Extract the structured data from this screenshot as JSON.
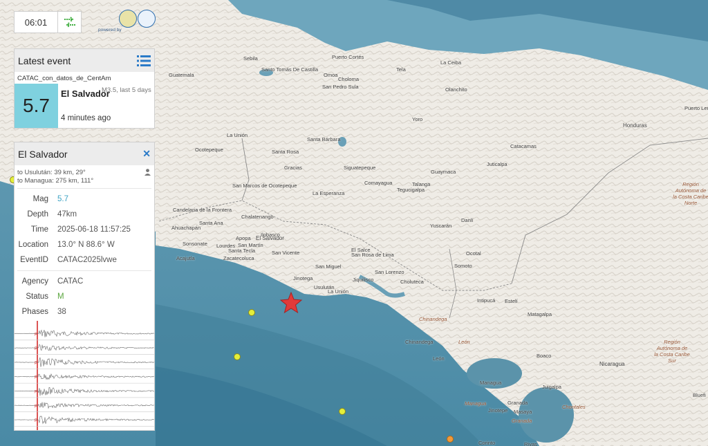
{
  "clock": {
    "time": "06:01"
  },
  "logos": {
    "powered_by": "powered by",
    "primary_color": "#2f6fb0"
  },
  "latest": {
    "title": "Latest event",
    "source": "CATAC_con_datos_de_CentAm",
    "magnitude": "5.7",
    "region": "El Salvador",
    "other": "M3.5, last 5 days",
    "ago": "4 minutes ago",
    "mag_color": "#7fd1df"
  },
  "detail": {
    "title": "El Salvador",
    "dist1": "to Usulután: 39 km, 29°",
    "dist2": "to Managua: 275 km, 111°",
    "mag_label": "Mag",
    "mag_value": "5.7",
    "depth_label": "Depth",
    "depth_value": "47km",
    "time_label": "Time",
    "time_value": "2025-06-18 11:57:25",
    "location_label": "Location",
    "location_value": "13.0° N 88.6° W",
    "eventid_label": "EventID",
    "eventid_value": "CATAC2025lvwe",
    "agency_label": "Agency",
    "agency_value": "CATAC",
    "status_label": "Status",
    "status_value": "M",
    "phases_label": "Phases",
    "phases_value": "38",
    "trace_count": 7
  },
  "map": {
    "places": [
      {
        "name": "Puerto Cortés",
        "type": "city"
      },
      {
        "name": "Sebila",
        "type": "city"
      },
      {
        "name": "Santo Tomás De Castilla",
        "type": "city"
      },
      {
        "name": "Omoa",
        "type": "city"
      },
      {
        "name": "Choloma",
        "type": "city"
      },
      {
        "name": "San Pedro Sula",
        "type": "city"
      },
      {
        "name": "La Ceiba",
        "type": "city"
      },
      {
        "name": "Tela",
        "type": "city"
      },
      {
        "name": "Olanchito",
        "type": "city"
      },
      {
        "name": "Guatemala",
        "type": "city"
      },
      {
        "name": "Yoro",
        "type": "city"
      },
      {
        "name": "Honduras",
        "type": "country"
      },
      {
        "name": "Puerto Lempira",
        "type": "city"
      },
      {
        "name": "La Unión",
        "type": "city"
      },
      {
        "name": "Ocotepeque",
        "type": "city"
      },
      {
        "name": "Santa Rosa",
        "type": "city"
      },
      {
        "name": "Santa Bárbara",
        "type": "city"
      },
      {
        "name": "Gracias",
        "type": "city"
      },
      {
        "name": "Siguatepeque",
        "type": "city"
      },
      {
        "name": "Comayagua",
        "type": "city"
      },
      {
        "name": "Talanga",
        "type": "city"
      },
      {
        "name": "Guaymaca",
        "type": "city"
      },
      {
        "name": "Juticalpa",
        "type": "city"
      },
      {
        "name": "Catacamas",
        "type": "city"
      },
      {
        "name": "Región Autónoma de la Costa Caribe Norte",
        "type": "region"
      },
      {
        "name": "San Marcos de Ocotepeque",
        "type": "city"
      },
      {
        "name": "La Esperanza",
        "type": "city"
      },
      {
        "name": "Tegucigalpa",
        "type": "city"
      },
      {
        "name": "Candelaria de la Frontera",
        "type": "city"
      },
      {
        "name": "Chalatenango",
        "type": "city"
      },
      {
        "name": "Santa Ana",
        "type": "city"
      },
      {
        "name": "Ahuachapán",
        "type": "city"
      },
      {
        "name": "Sonsonate",
        "type": "city"
      },
      {
        "name": "Apopa",
        "type": "city"
      },
      {
        "name": "El Salvador",
        "type": "country"
      },
      {
        "name": "Ilobasco",
        "type": "city"
      },
      {
        "name": "Lourdes",
        "type": "city"
      },
      {
        "name": "San Martín",
        "type": "city"
      },
      {
        "name": "Santa Tecla",
        "type": "city"
      },
      {
        "name": "Acajutla",
        "type": "city"
      },
      {
        "name": "Zacatecoluca",
        "type": "city"
      },
      {
        "name": "San Vicente",
        "type": "city"
      },
      {
        "name": "Yuscarán",
        "type": "city"
      },
      {
        "name": "Danlí",
        "type": "city"
      },
      {
        "name": "El Salce",
        "type": "city"
      },
      {
        "name": "San Rosa de Lima",
        "type": "city"
      },
      {
        "name": "San Miguel",
        "type": "city"
      },
      {
        "name": "San Lorenzo",
        "type": "city"
      },
      {
        "name": "Choluteca",
        "type": "city"
      },
      {
        "name": "Ocotal",
        "type": "city"
      },
      {
        "name": "Somoto",
        "type": "city"
      },
      {
        "name": "Jinotega",
        "type": "city"
      },
      {
        "name": "Usulután",
        "type": "city"
      },
      {
        "name": "Jiquilisco",
        "type": "city"
      },
      {
        "name": "La Unión",
        "type": "city"
      },
      {
        "name": "Intipucá",
        "type": "city"
      },
      {
        "name": "Estelí",
        "type": "city"
      },
      {
        "name": "Matagalpa",
        "type": "city"
      },
      {
        "name": "Chinandega",
        "type": "region"
      },
      {
        "name": "Chinandega",
        "type": "city"
      },
      {
        "name": "León",
        "type": "region"
      },
      {
        "name": "León",
        "type": "city"
      },
      {
        "name": "Región Autónoma de la Costa Caribe Sur",
        "type": "region"
      },
      {
        "name": "Boaco",
        "type": "city"
      },
      {
        "name": "Juigalpa",
        "type": "city"
      },
      {
        "name": "Nicaragua",
        "type": "country"
      },
      {
        "name": "Managua",
        "type": "city"
      },
      {
        "name": "Managua",
        "type": "region"
      },
      {
        "name": "Granada",
        "type": "city"
      },
      {
        "name": "Masaya",
        "type": "city"
      },
      {
        "name": "Jinotepe",
        "type": "city"
      },
      {
        "name": "Granada",
        "type": "region"
      },
      {
        "name": "Chontales",
        "type": "region"
      },
      {
        "name": "Rivas",
        "type": "city"
      },
      {
        "name": "Corinto",
        "type": "city"
      },
      {
        "name": "Bluefi",
        "type": "city"
      }
    ],
    "colors": {
      "land": "#f3f1ec",
      "water": "#5b93aa",
      "deep": "#3e7e9a",
      "star": "#e23a3a",
      "dot": "#e4ef3a",
      "dot_orange": "#f29a3a"
    }
  }
}
